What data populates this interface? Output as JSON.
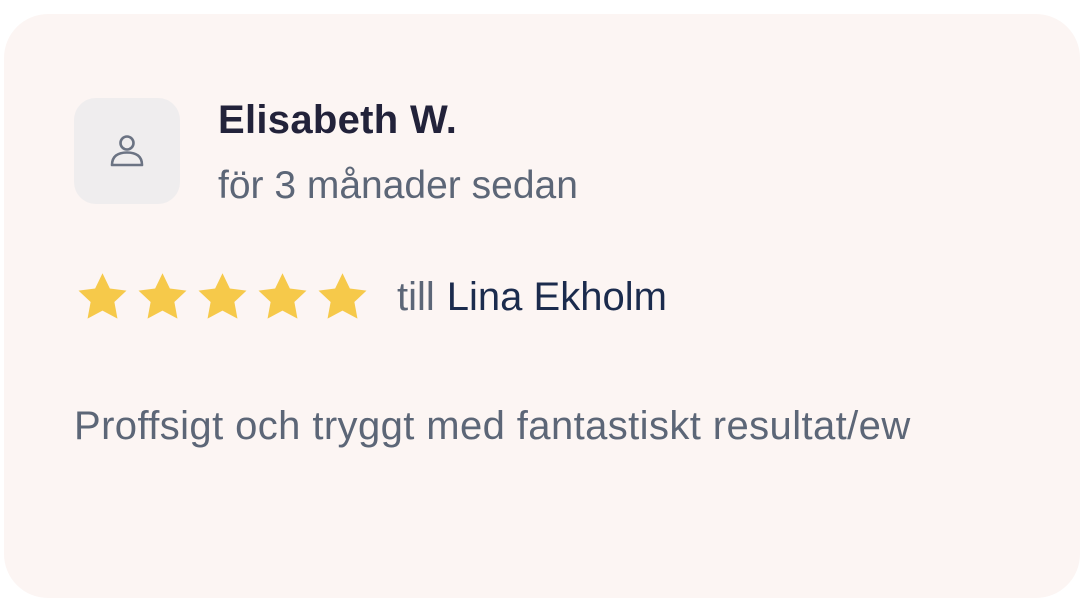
{
  "review": {
    "reviewer_name": "Elisabeth W.",
    "date": "för 3 månader sedan",
    "avatar_icon": "user-icon",
    "rating": 5,
    "rating_max": 5,
    "till_label": "till",
    "recipient": "Lina Ekholm",
    "body": "Proffsigt och tryggt med fantastiskt resultat/ew"
  },
  "colors": {
    "card_background": "#fcf5f3",
    "star": "#f6c94a",
    "name": "#22223a",
    "muted_text": "#5c6677",
    "recipient": "#1b2b4d"
  }
}
